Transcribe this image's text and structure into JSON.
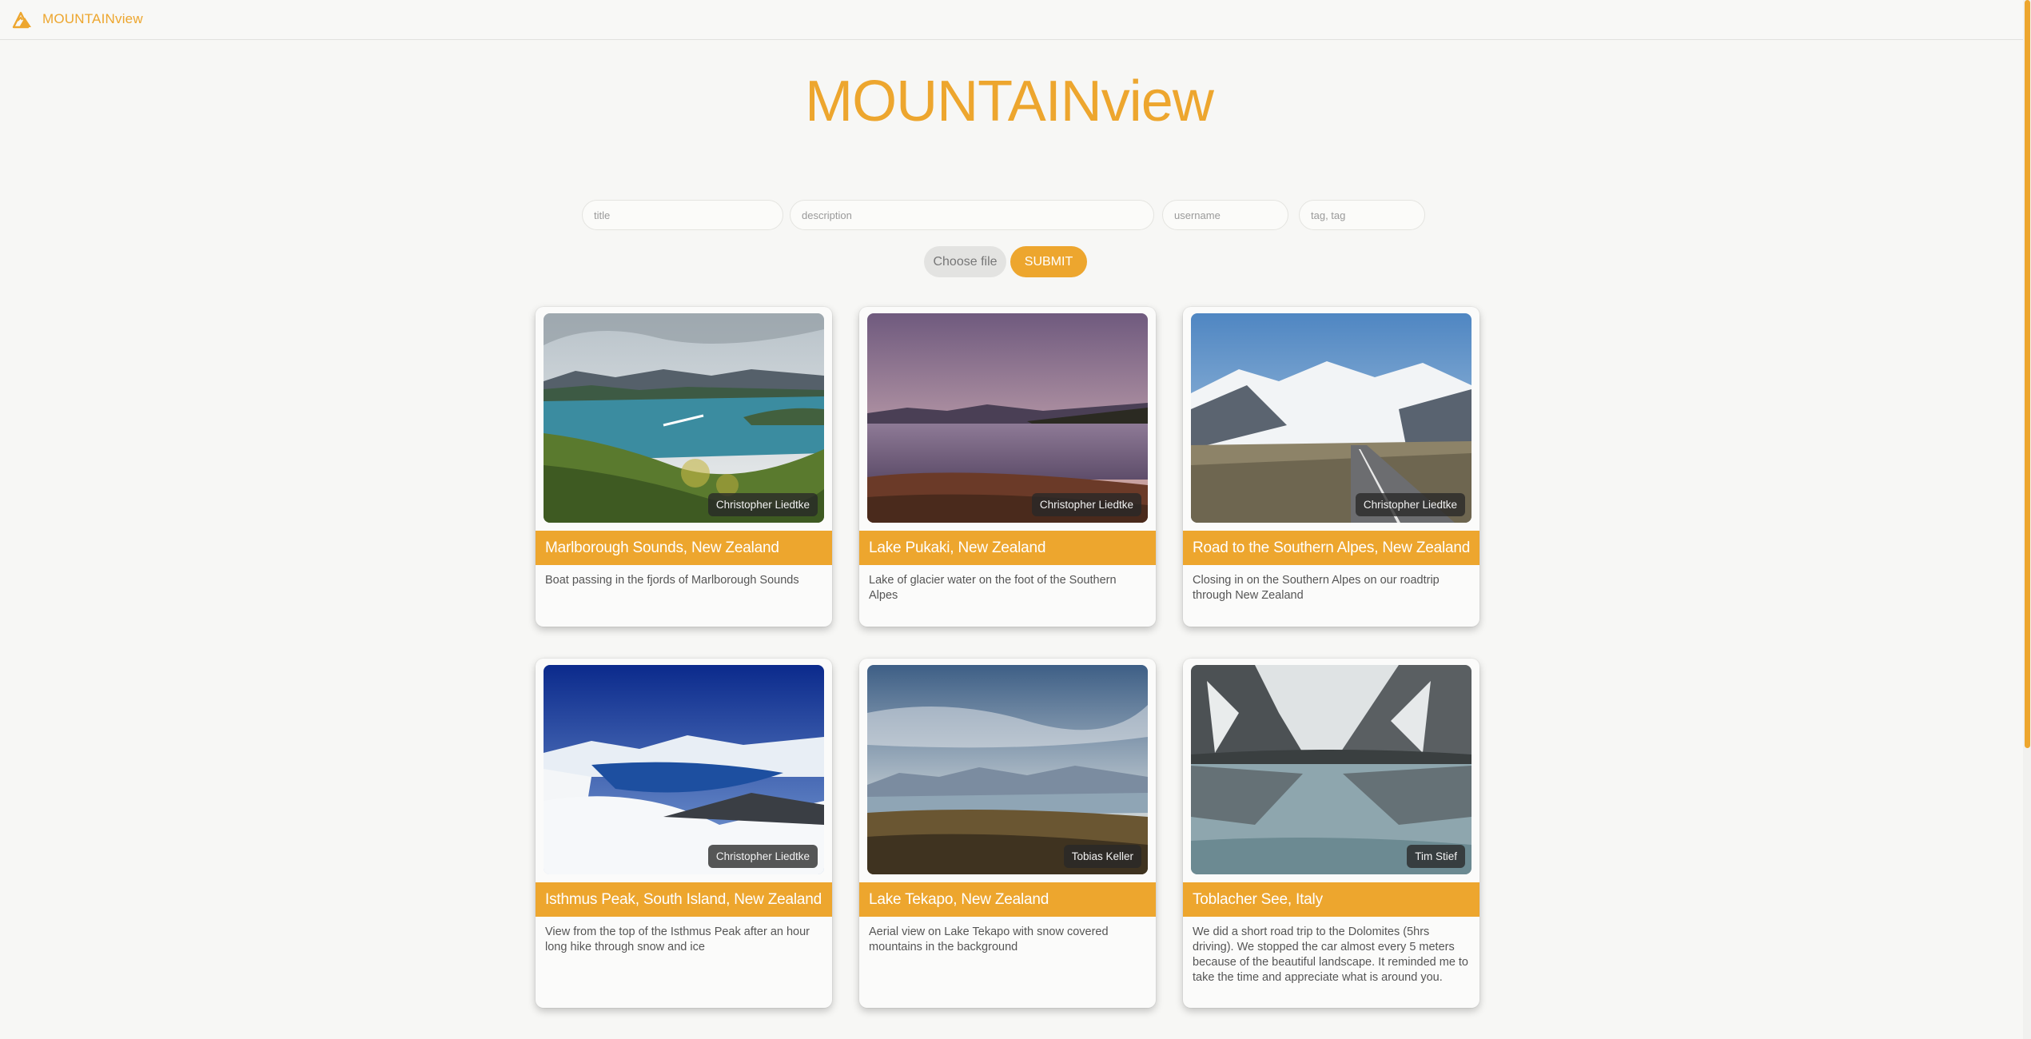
{
  "theme": {
    "accent": "#eda62e"
  },
  "nav": {
    "brand": "MOUNTAINview",
    "logo_icon": "mountain-logo-icon"
  },
  "page": {
    "title": "MOUNTAINview"
  },
  "form": {
    "title_placeholder": "title",
    "description_placeholder": "description",
    "username_placeholder": "username",
    "tags_placeholder": "tag, tag",
    "choose_file_label": "Choose file",
    "submit_label": "SUBMIT"
  },
  "cards": [
    {
      "title": "Marlborough Sounds, New Zealand",
      "author": "Christopher Liedtke",
      "description": "Boat passing in the fjords of Marlborough Sounds"
    },
    {
      "title": "Lake Pukaki, New Zealand",
      "author": "Christopher Liedtke",
      "description": "Lake of glacier water on the foot of the Southern Alpes"
    },
    {
      "title": "Road to the Southern Alpes, New Zealand",
      "author": "Christopher Liedtke",
      "description": "Closing in on the Southern Alpes on our roadtrip through New Zealand"
    },
    {
      "title": "Isthmus Peak, South Island, New Zealand",
      "author": "Christopher Liedtke",
      "description": "View from the top of the Isthmus Peak after an hour long hike through snow and ice"
    },
    {
      "title": "Lake Tekapo, New Zealand",
      "author": "Tobias Keller",
      "description": "Aerial view on Lake Tekapo with snow covered mountains in the background"
    },
    {
      "title": "Toblacher See, Italy",
      "author": "Tim Stief",
      "description": "We did a short road trip to the Dolomites (5hrs driving). We stopped the car almost every 5 meters because of the beautiful landscape. It reminded me to take the time and appreciate what is around you."
    }
  ]
}
